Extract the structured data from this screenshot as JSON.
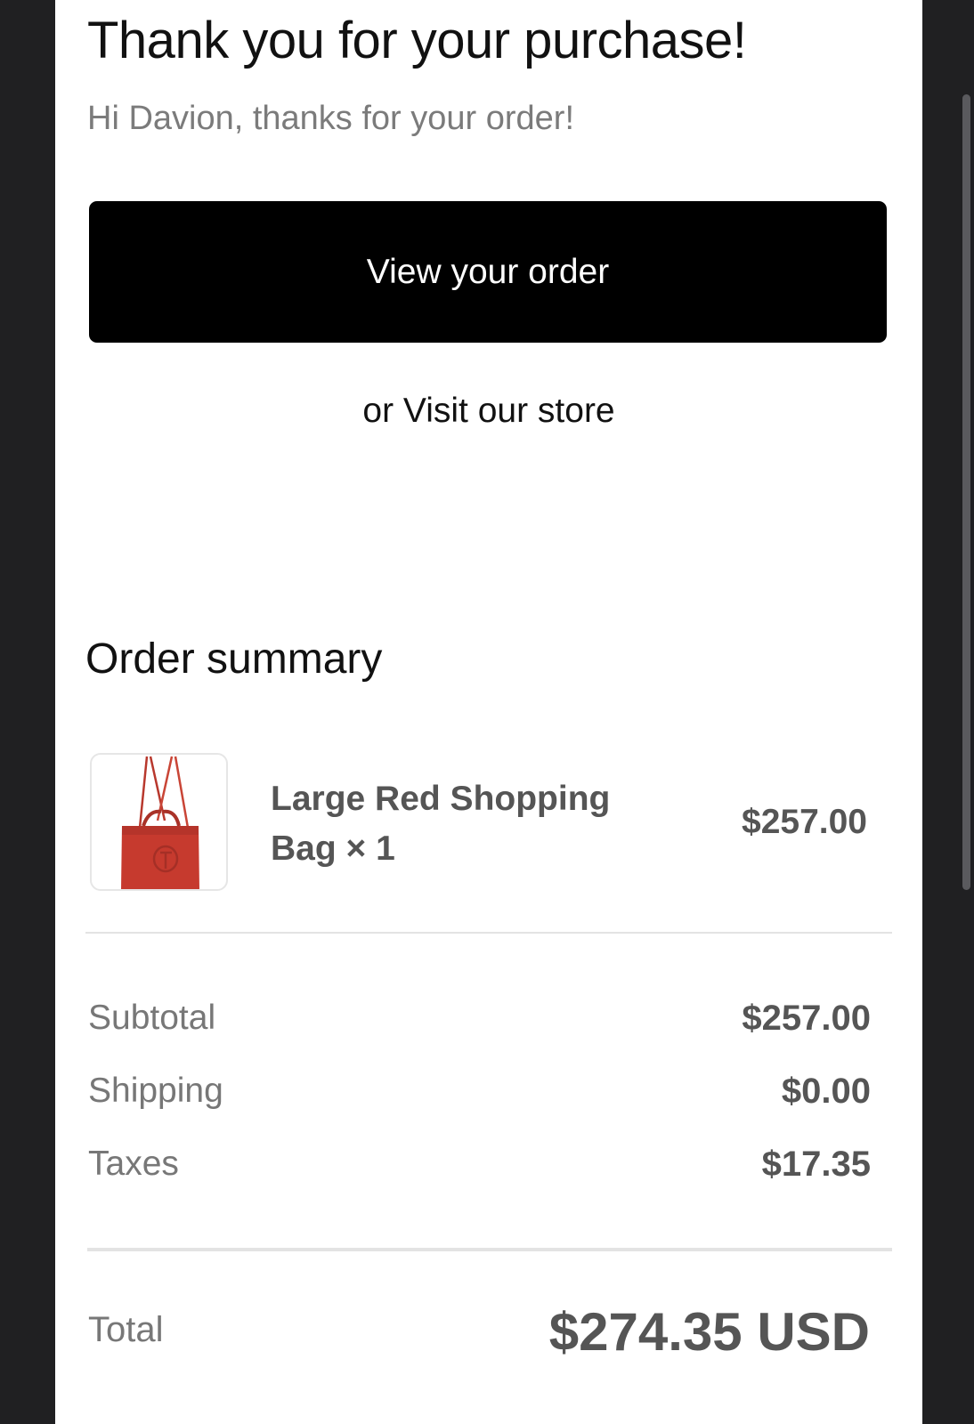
{
  "header": {
    "title": "Thank you for your purchase!",
    "greeting": "Hi Davion, thanks for your order!"
  },
  "actions": {
    "view_order_label": "View your order",
    "store_prefix": "or",
    "store_link_label": "Visit our store"
  },
  "summary": {
    "title": "Order summary",
    "items": [
      {
        "name": "Large Red Shopping Bag × 1",
        "price": "$257.00",
        "image_icon": "red-shopping-bag-image"
      }
    ],
    "rows": [
      {
        "label": "Subtotal",
        "value": "$257.00"
      },
      {
        "label": "Shipping",
        "value": "$0.00"
      },
      {
        "label": "Taxes",
        "value": "$17.35"
      }
    ],
    "total": {
      "label": "Total",
      "value": "$274.35 USD"
    }
  },
  "colors": {
    "background": "#202022",
    "button": "#000000",
    "bag_red": "#c63a2e",
    "muted_text": "#777777",
    "value_text": "#555555"
  }
}
